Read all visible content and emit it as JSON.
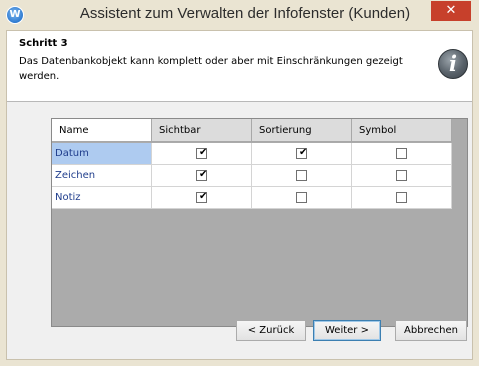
{
  "window": {
    "title": "Assistent zum Verwalten der Infofenster (Kunden)",
    "close_label": "✕",
    "app_icon_letter": "W"
  },
  "header": {
    "step": "Schritt 3",
    "description": "Das Datenbankobjekt kann komplett oder aber mit Einschränkungen gezeigt werden.",
    "info_icon": "i"
  },
  "grid": {
    "columns": [
      "Name",
      "Sichtbar",
      "Sortierung",
      "Symbol"
    ],
    "rows": [
      {
        "name": "Datum",
        "sichtbar": true,
        "sortierung": true,
        "symbol": false,
        "selected": true
      },
      {
        "name": "Zeichen",
        "sichtbar": true,
        "sortierung": false,
        "symbol": false,
        "selected": false
      },
      {
        "name": "Notiz",
        "sichtbar": true,
        "sortierung": false,
        "symbol": false,
        "selected": false
      }
    ]
  },
  "buttons": {
    "back": "< Zurück",
    "next": "Weiter >",
    "cancel": "Abbrechen"
  }
}
